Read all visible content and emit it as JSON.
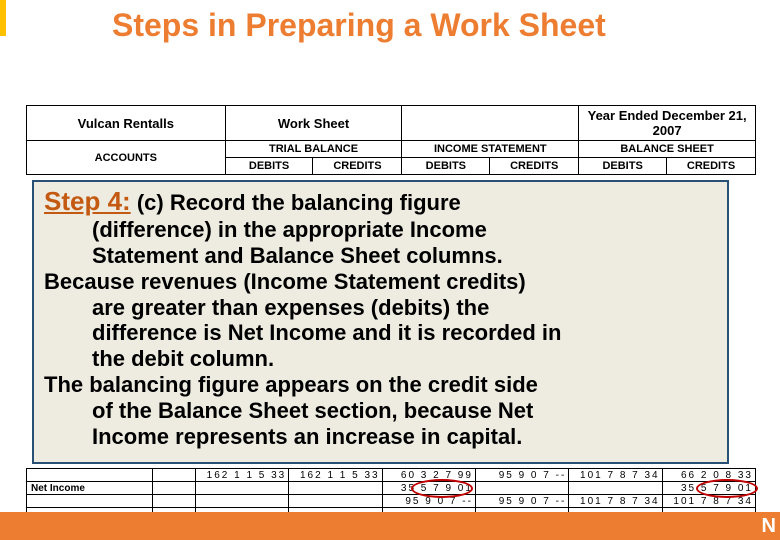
{
  "title": "Steps in Preparing a Work Sheet",
  "header": {
    "company": "Vulcan Rentalls",
    "docTitle": "Work Sheet",
    "period": " ",
    "periodEnd": "Year Ended December 21, 2007",
    "accounts": "ACCOUNTS",
    "sections": [
      "TRIAL BALANCE",
      "INCOME STATEMENT",
      "BALANCE SHEET"
    ],
    "dc": [
      "DEBITS",
      "CREDITS"
    ]
  },
  "step": {
    "label": "Step 4:",
    "line0": " (c) Record the balancing figure",
    "line1": "(difference) in the appropriate Income",
    "line2": "Statement and Balance Sheet columns.",
    "line3": "Because revenues (Income Statement credits)",
    "line4": "are greater than expenses (debits) the",
    "line5": "difference is Net Income and it is recorded in",
    "line6": "the debit column.",
    "line7": "The balancing figure appears on the credit side",
    "line8": "of the Balance Sheet section, because Net",
    "line9": "Income represents an increase in capital."
  },
  "netIncomeLabel": "Net Income",
  "rows": {
    "0": [
      "162 1 1 5 33",
      "162 1 1 5 33",
      "60 3 2 7 99",
      "95 9 0 7 --",
      "101 7 8 7 34",
      "66 2 0 8 33"
    ],
    "1": {
      "2": "35 5 7 9 01",
      "5": "35 5 7 9 01"
    },
    "2": {
      "2": "95 9 0 7 --",
      "3": "95 9 0 7 --",
      "4": "101 7 8 7 34",
      "5": "101 7 8 7 34"
    }
  },
  "footerLetter": "N"
}
